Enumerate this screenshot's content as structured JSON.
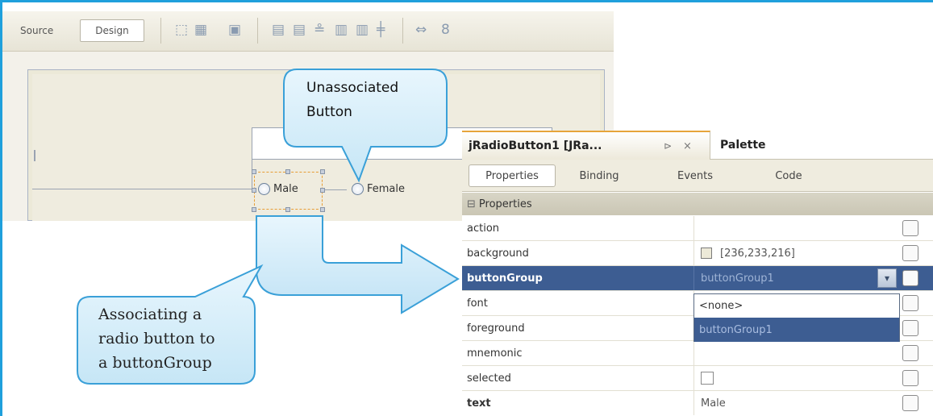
{
  "toolbar": {
    "source_label": "Source",
    "design_label": "Design",
    "icons": [
      "selection-mode-icon",
      "connection-mode-icon",
      "preview-design-icon",
      "align-left-icon",
      "align-right-icon",
      "center-horizontally-icon",
      "align-top-icon",
      "align-bottom-icon",
      "center-vertically-icon",
      "change-horizontal-resizability-icon",
      "change-vertical-resizability-icon"
    ]
  },
  "form": {
    "radio_male_label": "Male",
    "radio_female_label": "Female"
  },
  "callouts": {
    "unassociated": [
      "Unassociated",
      "Button"
    ],
    "associating": [
      "Associating a",
      "radio button to",
      "a buttonGroup"
    ]
  },
  "properties_panel": {
    "title": "jRadioButton1 [JRa...",
    "palette_tab": "Palette",
    "tabs": [
      "Properties",
      "Binding",
      "Events",
      "Code"
    ],
    "active_tab": "Properties",
    "group_label": "Properties",
    "rows": [
      {
        "name": "action",
        "value": ""
      },
      {
        "name": "background",
        "value": "[236,233,216]"
      },
      {
        "name": "buttonGroup",
        "value": "buttonGroup1"
      },
      {
        "name": "font",
        "value": ""
      },
      {
        "name": "foreground",
        "value": ""
      },
      {
        "name": "mnemonic",
        "value": ""
      },
      {
        "name": "selected",
        "value": ""
      },
      {
        "name": "text",
        "value": "Male"
      }
    ],
    "dropdown_options": [
      "<none>",
      "buttonGroup1"
    ],
    "highlighted_option": "buttonGroup1"
  },
  "colors": {
    "frame": "#1fa0dc",
    "callout_border": "#3aa0d8",
    "selection_row": "#3d5d92"
  }
}
